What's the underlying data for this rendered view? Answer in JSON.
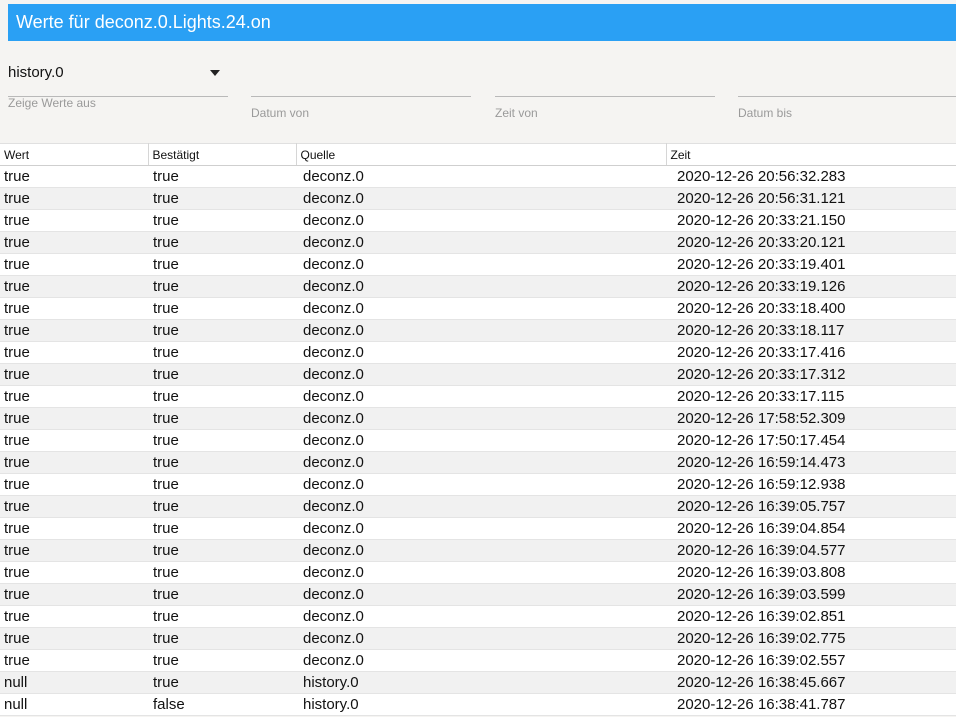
{
  "title": "Werte für deconz.0.Lights.24.on",
  "filters": {
    "source": {
      "value": "history.0",
      "label": "Zeige Werte aus"
    },
    "date_from": {
      "label": "Datum von"
    },
    "time_from": {
      "label": "Zeit von"
    },
    "date_to": {
      "label": "Datum bis"
    }
  },
  "table": {
    "headers": [
      "Wert",
      "Bestätigt",
      "Quelle",
      "Zeit"
    ],
    "rows": [
      [
        "true",
        "true",
        "deconz.0",
        "2020-12-26 20:56:32.283"
      ],
      [
        "true",
        "true",
        "deconz.0",
        "2020-12-26 20:56:31.121"
      ],
      [
        "true",
        "true",
        "deconz.0",
        "2020-12-26 20:33:21.150"
      ],
      [
        "true",
        "true",
        "deconz.0",
        "2020-12-26 20:33:20.121"
      ],
      [
        "true",
        "true",
        "deconz.0",
        "2020-12-26 20:33:19.401"
      ],
      [
        "true",
        "true",
        "deconz.0",
        "2020-12-26 20:33:19.126"
      ],
      [
        "true",
        "true",
        "deconz.0",
        "2020-12-26 20:33:18.400"
      ],
      [
        "true",
        "true",
        "deconz.0",
        "2020-12-26 20:33:18.117"
      ],
      [
        "true",
        "true",
        "deconz.0",
        "2020-12-26 20:33:17.416"
      ],
      [
        "true",
        "true",
        "deconz.0",
        "2020-12-26 20:33:17.312"
      ],
      [
        "true",
        "true",
        "deconz.0",
        "2020-12-26 20:33:17.115"
      ],
      [
        "true",
        "true",
        "deconz.0",
        "2020-12-26 17:58:52.309"
      ],
      [
        "true",
        "true",
        "deconz.0",
        "2020-12-26 17:50:17.454"
      ],
      [
        "true",
        "true",
        "deconz.0",
        "2020-12-26 16:59:14.473"
      ],
      [
        "true",
        "true",
        "deconz.0",
        "2020-12-26 16:59:12.938"
      ],
      [
        "true",
        "true",
        "deconz.0",
        "2020-12-26 16:39:05.757"
      ],
      [
        "true",
        "true",
        "deconz.0",
        "2020-12-26 16:39:04.854"
      ],
      [
        "true",
        "true",
        "deconz.0",
        "2020-12-26 16:39:04.577"
      ],
      [
        "true",
        "true",
        "deconz.0",
        "2020-12-26 16:39:03.808"
      ],
      [
        "true",
        "true",
        "deconz.0",
        "2020-12-26 16:39:03.599"
      ],
      [
        "true",
        "true",
        "deconz.0",
        "2020-12-26 16:39:02.851"
      ],
      [
        "true",
        "true",
        "deconz.0",
        "2020-12-26 16:39:02.775"
      ],
      [
        "true",
        "true",
        "deconz.0",
        "2020-12-26 16:39:02.557"
      ],
      [
        "null",
        "true",
        "history.0",
        "2020-12-26 16:38:45.667"
      ],
      [
        "null",
        "false",
        "history.0",
        "2020-12-26 16:38:41.787"
      ]
    ]
  },
  "colors": {
    "header_bar": "#2aa0f4",
    "background": "#f5f4f2"
  },
  "icons": {
    "dropdown": "caret-down-icon"
  }
}
